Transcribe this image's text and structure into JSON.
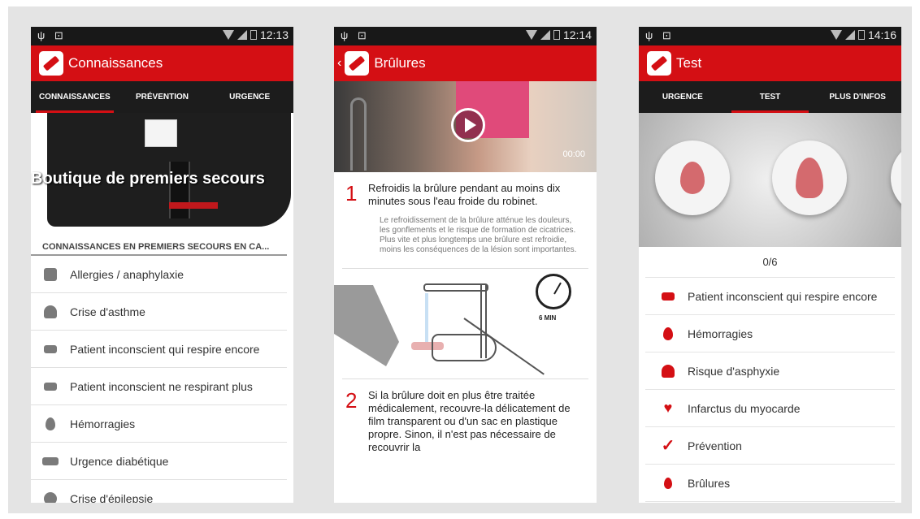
{
  "screens": [
    {
      "status": {
        "left": "ψ ⊡",
        "time": "12:13"
      },
      "title": "Connaissances",
      "tabs": [
        "CONNAISSANCES",
        "PRÉVENTION",
        "URGENCE"
      ],
      "hero_title": "Boutique de premiers secours",
      "section_title": "CONNAISSANCES EN PREMIERS SECOURS EN CA...",
      "items": [
        {
          "label": "Allergies / anaphylaxie",
          "icon": "allergy-icon"
        },
        {
          "label": "Crise d'asthme",
          "icon": "asthma-icon"
        },
        {
          "label": "Patient inconscient qui respire encore",
          "icon": "unconscious-breathing-icon"
        },
        {
          "label": "Patient inconscient ne respirant plus",
          "icon": "unconscious-not-breathing-icon"
        },
        {
          "label": "Hémorragies",
          "icon": "blood-drop-icon"
        },
        {
          "label": "Urgence diabétique",
          "icon": "diabetes-icon"
        },
        {
          "label": "Crise d'épilepsie",
          "icon": "epilepsy-icon"
        }
      ]
    },
    {
      "status": {
        "left": "ψ ⊡",
        "time": "12:14"
      },
      "back": "‹",
      "title": "Brûlures",
      "video_time": "00:00",
      "steps": [
        {
          "num": "1",
          "text": "Refroidis la brûlure pendant au moins dix minutes sous l'eau froide du robinet.",
          "desc": "Le refroidissement de la brûlure atténue les douleurs, les gonflements et le risque de formation de cicatrices. Plus vite et plus longtemps une brûlure est refroidie, moins les conséquences de la lésion sont importantes."
        },
        {
          "num": "2",
          "text": "Si la brûlure doit en plus être traitée médicalement, recouvre-la délicatement de film transparent ou d'un sac en plastique propre. Sinon, il n'est pas nécessaire de recouvrir la"
        }
      ],
      "clock_label": "6 MIN"
    },
    {
      "status": {
        "left": "ψ ⊡",
        "time": "14:16"
      },
      "title": "Test",
      "tabs": [
        "URGENCE",
        "TEST",
        "PLUS D'INFOS"
      ],
      "score": "0/6",
      "items": [
        {
          "label": "Patient inconscient qui respire encore",
          "icon": "unconscious-breathing-icon"
        },
        {
          "label": "Hémorragies",
          "icon": "blood-drop-icon"
        },
        {
          "label": "Risque d'asphyxie",
          "icon": "asphyxia-icon"
        },
        {
          "label": "Infarctus du myocarde",
          "icon": "heart-icon"
        },
        {
          "label": "Prévention",
          "icon": "check-icon"
        },
        {
          "label": "Brûlures",
          "icon": "flame-icon"
        }
      ]
    }
  ],
  "colors": {
    "brand": "#d40f14",
    "tabbar": "#1c1c1c",
    "statusbar": "#181818"
  }
}
